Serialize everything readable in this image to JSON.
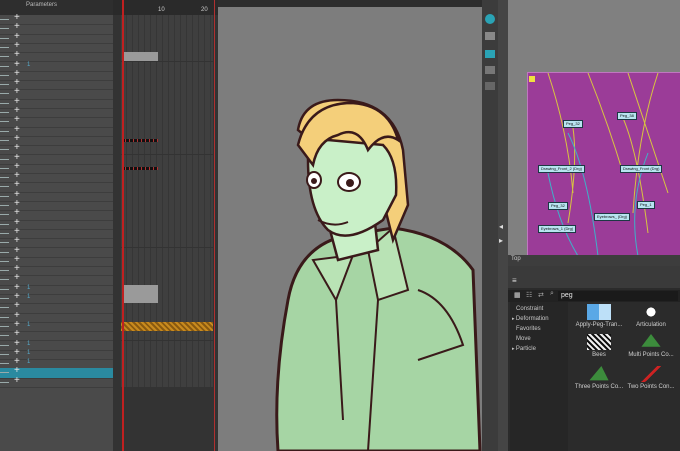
{
  "timeline": {
    "header_label": "Parameters",
    "ruler": {
      "mark_10": "10",
      "mark_20": "20"
    },
    "layer_ticks": [
      "1",
      "1",
      "1",
      "1",
      "1",
      "1",
      "1"
    ]
  },
  "library": {
    "title": "Top",
    "search_value": "peg",
    "categories": [
      "Constraint",
      "Deformation",
      "Favorites",
      "Move",
      "Particle"
    ],
    "templates": [
      {
        "label": "Apply-Peg-Tran..."
      },
      {
        "label": "Articulation"
      },
      {
        "label": "Bees"
      },
      {
        "label": "Multi Points Co..."
      },
      {
        "label": "Three Points Co..."
      },
      {
        "label": "Two Points Con..."
      }
    ]
  },
  "nodes": [
    {
      "label": "Peg_32"
    },
    {
      "label": "Peg_38"
    },
    {
      "label": "Drawing_Front_2 (Drg)"
    },
    {
      "label": "Drawing_Front (Drg)"
    },
    {
      "label": "Peg_32"
    },
    {
      "label": "Eyebrows_ (Drg)"
    },
    {
      "label": "Peg_1"
    },
    {
      "label": "Eyebrows_1 (Drg)"
    }
  ],
  "colors": {
    "selected_layer": "#2a8aa0",
    "node_group": "#9b3c98",
    "playhead": "#c02020"
  }
}
